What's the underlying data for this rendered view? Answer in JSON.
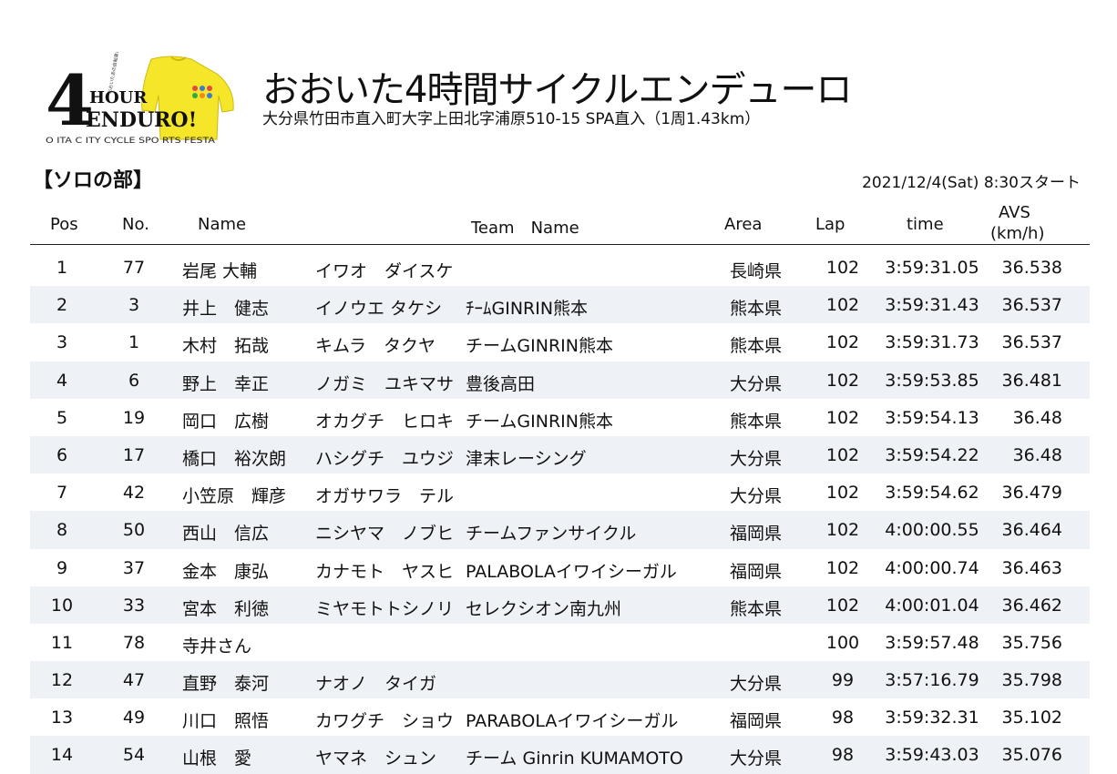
{
  "header": {
    "title": "おおいた4時間サイクルエンデューロ",
    "subtitle": "大分県竹田市直入町大字上田北字浦原510-15 SPA直入（1周1.43km）",
    "section": "【ソロの部】",
    "start": "2021/12/4(Sat) 8:30スタート"
  },
  "logo": {
    "big_number": "4",
    "hour": "HOUR",
    "enduro": "ENDURO!",
    "tagline": "O ITA C ITY CYCLE SPO RTS FESTA",
    "vertical": "おおいたあの自転車の祭典"
  },
  "columns": {
    "pos": "Pos",
    "no": "No.",
    "name": "Name",
    "team": "Team　Name",
    "area": "Area",
    "lap": "Lap",
    "time": "time",
    "avs": "AVS",
    "avs_unit": "(km/h)"
  },
  "rows": [
    {
      "pos": "1",
      "no": "77",
      "name": "岩尾 大輔",
      "kana": "イワオ　ダイスケ",
      "team": "",
      "area": "長崎県",
      "lap": "102",
      "time": "3:59:31.05",
      "avs": "36.538"
    },
    {
      "pos": "2",
      "no": "3",
      "name": "井上　健志",
      "kana": "イノウエ タケシ",
      "team": "ﾁｰﾑGINRIN熊本",
      "area": "熊本県",
      "lap": "102",
      "time": "3:59:31.43",
      "avs": "36.537"
    },
    {
      "pos": "3",
      "no": "1",
      "name": "木村　拓哉",
      "kana": "キムラ　タクヤ",
      "team": "チームGINRIN熊本",
      "area": "熊本県",
      "lap": "102",
      "time": "3:59:31.73",
      "avs": "36.537"
    },
    {
      "pos": "4",
      "no": "6",
      "name": "野上　幸正",
      "kana": "ノガミ　ユキマサ",
      "team": "豊後高田",
      "area": "大分県",
      "lap": "102",
      "time": "3:59:53.85",
      "avs": "36.481"
    },
    {
      "pos": "5",
      "no": "19",
      "name": "岡口　広樹",
      "kana": "オカグチ　ヒロキ",
      "team": "チームGINRIN熊本",
      "area": "熊本県",
      "lap": "102",
      "time": "3:59:54.13",
      "avs": "36.48"
    },
    {
      "pos": "6",
      "no": "17",
      "name": "橋口　裕次朗",
      "kana": "ハシグチ　ユウジ",
      "team": "津末レーシング",
      "area": "大分県",
      "lap": "102",
      "time": "3:59:54.22",
      "avs": "36.48"
    },
    {
      "pos": "7",
      "no": "42",
      "name": "小笠原　輝彦",
      "kana": "オガサワラ　テル",
      "team": "",
      "area": "大分県",
      "lap": "102",
      "time": "3:59:54.62",
      "avs": "36.479"
    },
    {
      "pos": "8",
      "no": "50",
      "name": "西山　信広",
      "kana": "ニシヤマ　ノブヒ",
      "team": "チームファンサイクル",
      "area": "福岡県",
      "lap": "102",
      "time": "4:00:00.55",
      "avs": "36.464"
    },
    {
      "pos": "9",
      "no": "37",
      "name": "金本　康弘",
      "kana": "カナモト　ヤスヒ",
      "team": "PALABOLAイワイシーガル",
      "area": "福岡県",
      "lap": "102",
      "time": "4:00:00.74",
      "avs": "36.463"
    },
    {
      "pos": "10",
      "no": "33",
      "name": "宮本　利徳",
      "kana": "ミヤモトトシノリ",
      "team": "セレクシオン南九州",
      "area": "熊本県",
      "lap": "102",
      "time": "4:00:01.04",
      "avs": "36.462"
    },
    {
      "pos": "11",
      "no": "78",
      "name": "寺井さん",
      "kana": "",
      "team": "",
      "area": "",
      "lap": "100",
      "time": "3:59:57.48",
      "avs": "35.756"
    },
    {
      "pos": "12",
      "no": "47",
      "name": "直野　泰河",
      "kana": "ナオノ　タイガ",
      "team": "",
      "area": "大分県",
      "lap": "99",
      "time": "3:57:16.79",
      "avs": "35.798"
    },
    {
      "pos": "13",
      "no": "49",
      "name": "川口　照悟",
      "kana": "カワグチ　ショウ",
      "team": "PARABOLAイワイシーガル",
      "area": "福岡県",
      "lap": "98",
      "time": "3:59:32.31",
      "avs": "35.102"
    },
    {
      "pos": "14",
      "no": "54",
      "name": "山根　愛",
      "kana": "ヤマネ　シュン",
      "team": "チーム Ginrin KUMAMOTO",
      "area": "大分県",
      "lap": "98",
      "time": "3:59:43.03",
      "avs": "35.076"
    }
  ]
}
